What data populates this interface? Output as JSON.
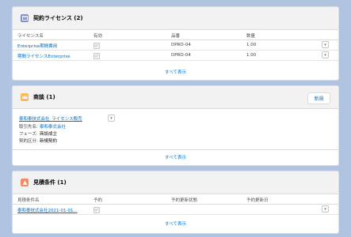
{
  "licenses": {
    "title": "契約ライセンス (2)",
    "icon_color": "#7f8de1",
    "columns": [
      "ライセンス名",
      "有効",
      "品番",
      "数量"
    ],
    "rows": [
      {
        "name": "Enterprise期間費用",
        "part": "DPRO-04",
        "qty": "1.00"
      },
      {
        "name": "期間ライセンスEnterprise",
        "part": "DPRO-04",
        "qty": "1.00"
      }
    ],
    "view_all": "すべて表示"
  },
  "deals": {
    "title": "商談 (1)",
    "icon_color": "#fcb95b",
    "new_label": "新規",
    "record_link": "泰和泰技式会社_ライセンス販売",
    "fields": [
      {
        "label": "取引先名:",
        "value": "泰和泰式会社",
        "is_link": true
      },
      {
        "label": "フェーズ:",
        "value": "商談成立",
        "is_link": false
      },
      {
        "label": "契約区分:",
        "value": "新規契約",
        "is_link": false
      }
    ],
    "view_all": "すべて表示"
  },
  "quotes": {
    "title": "見積条件 (1)",
    "icon_color": "#f88962",
    "columns": [
      "見積条件名",
      "予約",
      "予約更新状態",
      "予約更新日"
    ],
    "rows": [
      {
        "name": "泰和泰技式会社2021-01-01..."
      }
    ],
    "view_all": "すべて表示"
  }
}
